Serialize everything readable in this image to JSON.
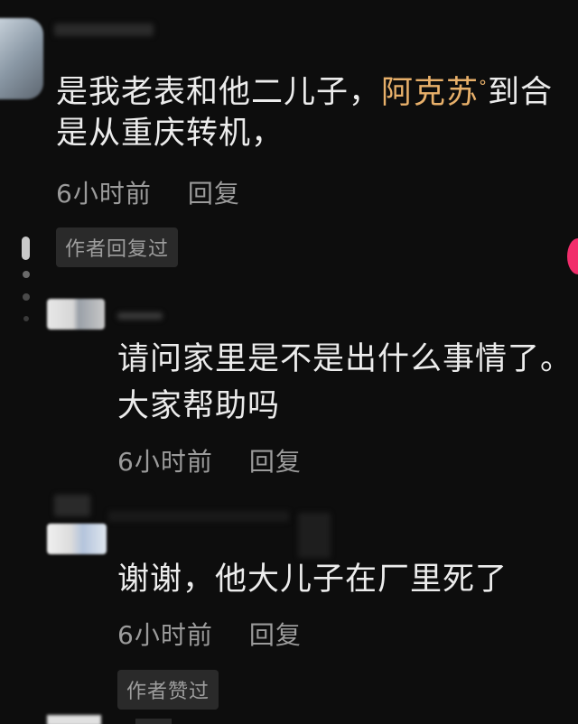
{
  "comment": {
    "line1": "是我老表和他二儿子，",
    "hashtag": "阿克苏",
    "line1_tail": "到合",
    "line2": "是从重庆转机，",
    "time": "6小时前",
    "reply_label": "回复",
    "badge": "作者回复过"
  },
  "reply1": {
    "line1": "请问家里是不是出什么事情了。",
    "line2": "大家帮助吗",
    "time": "6小时前",
    "reply_label": "回复"
  },
  "reply2": {
    "line1": "谢谢，他大儿子在厂里死了",
    "time": "6小时前",
    "reply_label": "回复",
    "badge": "作者赞过"
  },
  "colors": {
    "background": "#0d0d0d",
    "hashtag": "#e8b06a",
    "meta": "#9b9b9b",
    "accent_pink": "#f12d6b"
  }
}
